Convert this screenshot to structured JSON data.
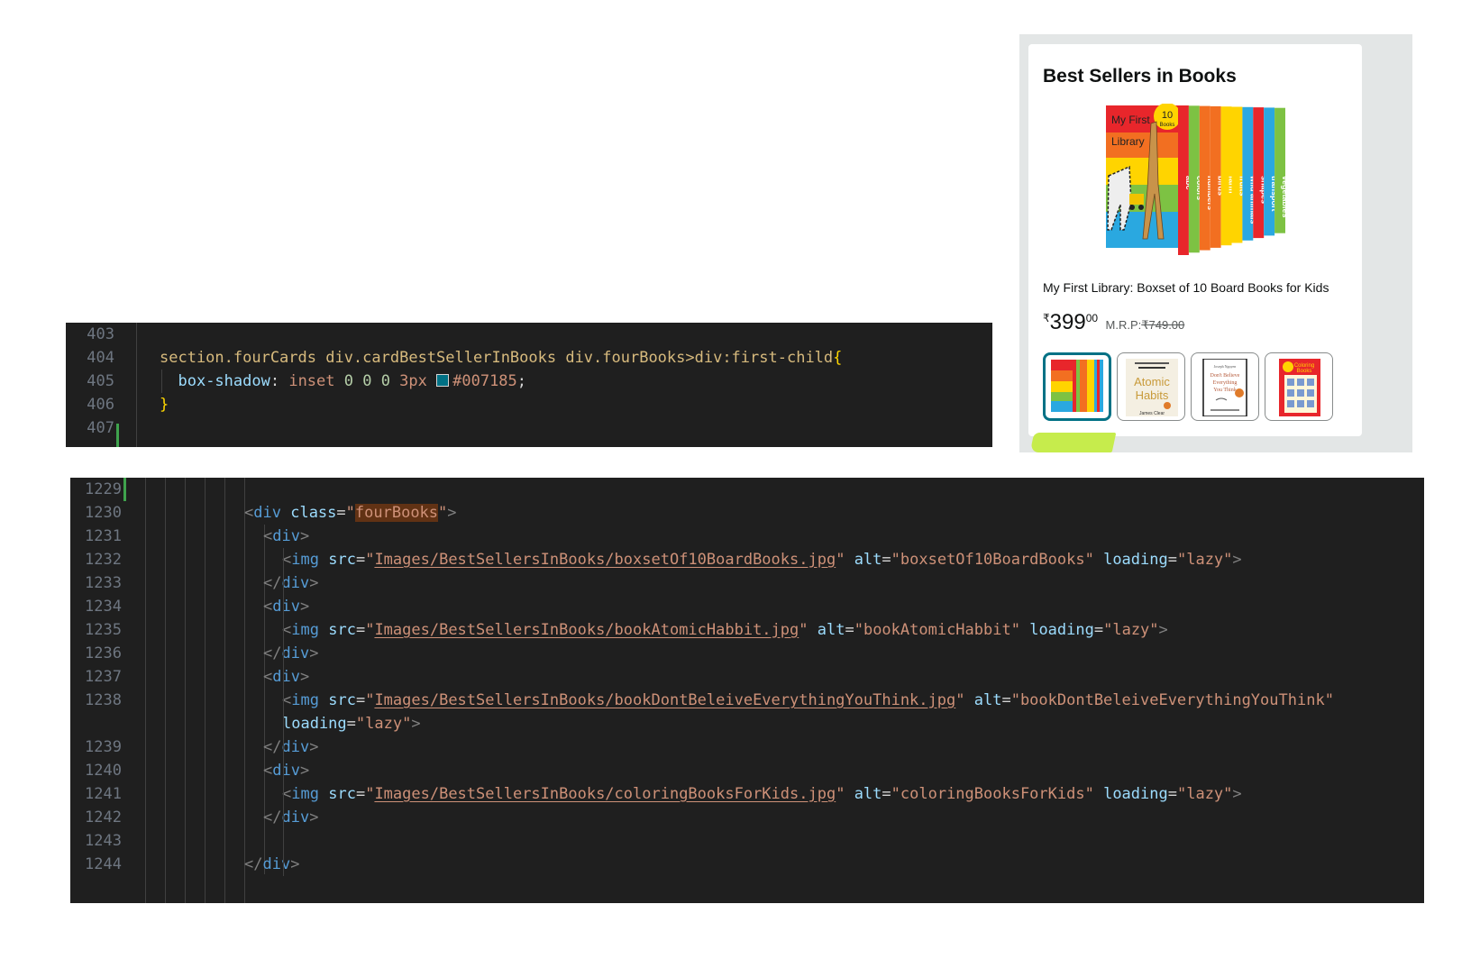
{
  "css_editor": {
    "lines": [
      {
        "number": "403",
        "tokens": []
      },
      {
        "number": "404",
        "tokens": [
          {
            "cls": "sel",
            "text": "section.fourCards div.cardBestSellerInBooks div.fourBooks>div:first-child"
          },
          {
            "cls": "brace",
            "text": "{"
          }
        ]
      },
      {
        "number": "405",
        "indent": "  ",
        "tokens": [
          {
            "cls": "prop",
            "text": "box-shadow"
          },
          {
            "cls": "punc",
            "text": ": "
          },
          {
            "cls": "val",
            "text": "inset "
          },
          {
            "cls": "num",
            "text": "0 0 0 "
          },
          {
            "cls": "val",
            "text": "3px "
          },
          {
            "cls": "swatch",
            "color": "#007185",
            "text": ""
          },
          {
            "cls": "val",
            "text": "#007185"
          },
          {
            "cls": "punc",
            "text": ";"
          }
        ]
      },
      {
        "number": "406",
        "tokens": [
          {
            "cls": "brace",
            "text": "}"
          }
        ]
      },
      {
        "number": "407",
        "tokens": []
      }
    ]
  },
  "html_editor": {
    "lines": [
      {
        "number": "1229",
        "indent": 0,
        "tokens": []
      },
      {
        "number": "1230",
        "indent": 0,
        "tokens": [
          {
            "cls": "tagb",
            "text": "<"
          },
          {
            "cls": "tag",
            "text": "div"
          },
          {
            "cls": "punc",
            "text": " "
          },
          {
            "cls": "attr",
            "text": "class"
          },
          {
            "cls": "punc",
            "text": "="
          },
          {
            "cls": "str",
            "text": "\""
          },
          {
            "cls": "str hl",
            "text": "fourBooks"
          },
          {
            "cls": "str",
            "text": "\""
          },
          {
            "cls": "tagb",
            "text": ">"
          }
        ]
      },
      {
        "number": "1231",
        "indent": 1,
        "tokens": [
          {
            "cls": "tagb",
            "text": "<"
          },
          {
            "cls": "tag",
            "text": "div"
          },
          {
            "cls": "tagb",
            "text": ">"
          }
        ]
      },
      {
        "number": "1232",
        "indent": 2,
        "tokens": [
          {
            "cls": "tagb",
            "text": "<"
          },
          {
            "cls": "tag",
            "text": "img"
          },
          {
            "cls": "punc",
            "text": " "
          },
          {
            "cls": "attr",
            "text": "src"
          },
          {
            "cls": "punc",
            "text": "="
          },
          {
            "cls": "str",
            "text": "\""
          },
          {
            "cls": "link",
            "text": "Images/BestSellersInBooks/boxsetOf10BoardBooks.jpg"
          },
          {
            "cls": "str",
            "text": "\""
          },
          {
            "cls": "punc",
            "text": " "
          },
          {
            "cls": "attr",
            "text": "alt"
          },
          {
            "cls": "punc",
            "text": "="
          },
          {
            "cls": "str",
            "text": "\"boxsetOf10BoardBooks\""
          },
          {
            "cls": "punc",
            "text": " "
          },
          {
            "cls": "attr",
            "text": "loading"
          },
          {
            "cls": "punc",
            "text": "="
          },
          {
            "cls": "str",
            "text": "\"lazy\""
          },
          {
            "cls": "tagb",
            "text": ">"
          }
        ]
      },
      {
        "number": "1233",
        "indent": 1,
        "tokens": [
          {
            "cls": "tagb",
            "text": "</"
          },
          {
            "cls": "tag",
            "text": "div"
          },
          {
            "cls": "tagb",
            "text": ">"
          }
        ]
      },
      {
        "number": "1234",
        "indent": 1,
        "tokens": [
          {
            "cls": "tagb",
            "text": "<"
          },
          {
            "cls": "tag",
            "text": "div"
          },
          {
            "cls": "tagb",
            "text": ">"
          }
        ]
      },
      {
        "number": "1235",
        "indent": 2,
        "tokens": [
          {
            "cls": "tagb",
            "text": "<"
          },
          {
            "cls": "tag",
            "text": "img"
          },
          {
            "cls": "punc",
            "text": " "
          },
          {
            "cls": "attr",
            "text": "src"
          },
          {
            "cls": "punc",
            "text": "="
          },
          {
            "cls": "str",
            "text": "\""
          },
          {
            "cls": "link",
            "text": "Images/BestSellersInBooks/bookAtomicHabbit.jpg"
          },
          {
            "cls": "str",
            "text": "\""
          },
          {
            "cls": "punc",
            "text": " "
          },
          {
            "cls": "attr",
            "text": "alt"
          },
          {
            "cls": "punc",
            "text": "="
          },
          {
            "cls": "str",
            "text": "\"bookAtomicHabbit\""
          },
          {
            "cls": "punc",
            "text": " "
          },
          {
            "cls": "attr",
            "text": "loading"
          },
          {
            "cls": "punc",
            "text": "="
          },
          {
            "cls": "str",
            "text": "\"lazy\""
          },
          {
            "cls": "tagb",
            "text": ">"
          }
        ]
      },
      {
        "number": "1236",
        "indent": 1,
        "tokens": [
          {
            "cls": "tagb",
            "text": "</"
          },
          {
            "cls": "tag",
            "text": "div"
          },
          {
            "cls": "tagb",
            "text": ">"
          }
        ]
      },
      {
        "number": "1237",
        "indent": 1,
        "tokens": [
          {
            "cls": "tagb",
            "text": "<"
          },
          {
            "cls": "tag",
            "text": "div"
          },
          {
            "cls": "tagb",
            "text": ">"
          }
        ]
      },
      {
        "number": "1238",
        "indent": 2,
        "tokens": [
          {
            "cls": "tagb",
            "text": "<"
          },
          {
            "cls": "tag",
            "text": "img"
          },
          {
            "cls": "punc",
            "text": " "
          },
          {
            "cls": "attr",
            "text": "src"
          },
          {
            "cls": "punc",
            "text": "="
          },
          {
            "cls": "str",
            "text": "\""
          },
          {
            "cls": "link",
            "text": "Images/BestSellersInBooks/bookDontBeleiveEverythingYouThink.jpg"
          },
          {
            "cls": "str",
            "text": "\""
          },
          {
            "cls": "punc",
            "text": " "
          },
          {
            "cls": "attr",
            "text": "alt"
          },
          {
            "cls": "punc",
            "text": "="
          },
          {
            "cls": "str",
            "text": "\"bookDontBeleiveEverythingYouThink\""
          }
        ]
      },
      {
        "number": "",
        "indent": 2,
        "tokens": [
          {
            "cls": "attr",
            "text": "loading"
          },
          {
            "cls": "punc",
            "text": "="
          },
          {
            "cls": "str",
            "text": "\"lazy\""
          },
          {
            "cls": "tagb",
            "text": ">"
          }
        ]
      },
      {
        "number": "1239",
        "indent": 1,
        "tokens": [
          {
            "cls": "tagb",
            "text": "</"
          },
          {
            "cls": "tag",
            "text": "div"
          },
          {
            "cls": "tagb",
            "text": ">"
          }
        ]
      },
      {
        "number": "1240",
        "indent": 1,
        "tokens": [
          {
            "cls": "tagb",
            "text": "<"
          },
          {
            "cls": "tag",
            "text": "div"
          },
          {
            "cls": "tagb",
            "text": ">"
          }
        ]
      },
      {
        "number": "1241",
        "indent": 2,
        "tokens": [
          {
            "cls": "tagb",
            "text": "<"
          },
          {
            "cls": "tag",
            "text": "img"
          },
          {
            "cls": "punc",
            "text": " "
          },
          {
            "cls": "attr",
            "text": "src"
          },
          {
            "cls": "punc",
            "text": "="
          },
          {
            "cls": "str",
            "text": "\""
          },
          {
            "cls": "link",
            "text": "Images/BestSellersInBooks/coloringBooksForKids.jpg"
          },
          {
            "cls": "str",
            "text": "\""
          },
          {
            "cls": "punc",
            "text": " "
          },
          {
            "cls": "attr",
            "text": "alt"
          },
          {
            "cls": "punc",
            "text": "="
          },
          {
            "cls": "str",
            "text": "\"coloringBooksForKids\""
          },
          {
            "cls": "punc",
            "text": " "
          },
          {
            "cls": "attr",
            "text": "loading"
          },
          {
            "cls": "punc",
            "text": "="
          },
          {
            "cls": "str",
            "text": "\"lazy\""
          },
          {
            "cls": "tagb",
            "text": ">"
          }
        ]
      },
      {
        "number": "1242",
        "indent": 1,
        "tokens": [
          {
            "cls": "tagb",
            "text": "</"
          },
          {
            "cls": "tag",
            "text": "div"
          },
          {
            "cls": "tagb",
            "text": ">"
          }
        ]
      },
      {
        "number": "1243",
        "indent": 0,
        "tokens": []
      },
      {
        "number": "1244",
        "indent": 0,
        "tokens": [
          {
            "cls": "tagb",
            "text": "</"
          },
          {
            "cls": "tag",
            "text": "div"
          },
          {
            "cls": "tagb",
            "text": ">"
          }
        ]
      }
    ]
  },
  "card": {
    "title": "Best Sellers in Books",
    "hero_alt": "My First Library 10 Books boxset",
    "product_name": "My First Library: Boxset of 10 Board Books for Kids",
    "price": {
      "currency": "₹",
      "whole": "399",
      "fraction": "00",
      "mrp_label": "M.R.P:",
      "mrp_value": "₹749.00"
    },
    "thumbnails": [
      {
        "name": "boxsetOf10BoardBooks",
        "selected": true
      },
      {
        "name": "bookAtomicHabbit",
        "selected": false,
        "title_lines": [
          "Atomic",
          "Habits"
        ],
        "author": "James Clear"
      },
      {
        "name": "bookDontBeleiveEverythingYouThink",
        "selected": false,
        "title_lines": [
          "Don't Believe",
          "Everything",
          "You Think"
        ],
        "author": "Joseph Nguyen"
      },
      {
        "name": "coloringBooksForKids",
        "selected": false,
        "title_lines": [
          "Coloring",
          "Books"
        ]
      }
    ],
    "selected_border_color": "#007185"
  },
  "hero_book": {
    "cover_lines": [
      "My First",
      "Library"
    ],
    "badge": [
      "10",
      "Books"
    ],
    "spines": [
      {
        "word": "abc",
        "color": "#e8262b"
      },
      {
        "word": "colors",
        "color": "#7dc243"
      },
      {
        "word": "numbers",
        "color": "#f26f21"
      },
      {
        "word": "birds",
        "color": "#f26f21"
      },
      {
        "word": "farm",
        "color": "#ffd400"
      },
      {
        "word": "fruits",
        "color": "#ffd400"
      },
      {
        "word": "wild animals",
        "color": "#2aa8e0"
      },
      {
        "word": "shapes",
        "color": "#e8262b"
      },
      {
        "word": "transport",
        "color": "#2aa8e0"
      },
      {
        "word": "vegetables",
        "color": "#7dc243"
      }
    ]
  }
}
